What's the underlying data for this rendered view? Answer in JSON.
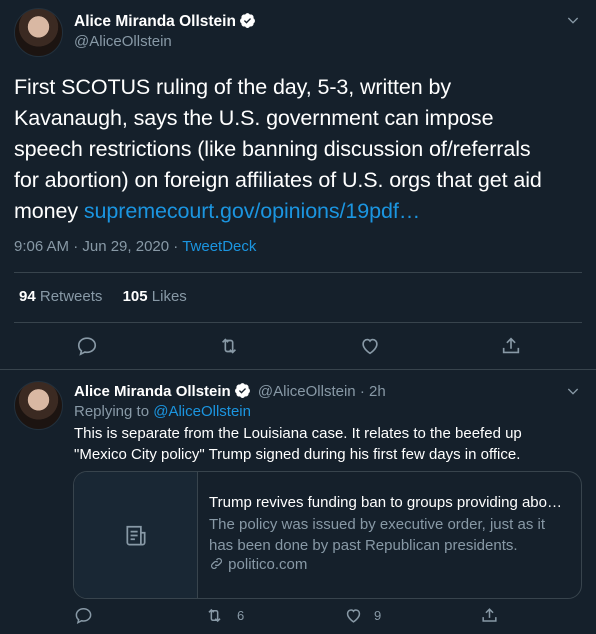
{
  "main_tweet": {
    "author_name": "Alice Miranda Ollstein",
    "handle": "@AliceOllstein",
    "text_line1": "First SCOTUS ruling of the day, 5-3, written by",
    "text_line2": "Kavanaugh, says the U.S. government can impose",
    "text_line3": "speech restrictions (like banning discussion of/referrals",
    "text_line4": "for abortion) on foreign affiliates of U.S. orgs that get aid",
    "text_line5_prefix": "money ",
    "link": "supremecourt.gov/opinions/19pdf…",
    "timestamp": "9:06 AM · Jun 29, 2020",
    "separator": "·",
    "client": "TweetDeck",
    "retweets_count": "94",
    "retweets_label": "Retweets",
    "likes_count": "105",
    "likes_label": "Likes"
  },
  "reply_tweet": {
    "author_name": "Alice Miranda Ollstein",
    "handle_time": "@AliceOllstein · 2h",
    "replying_to_label": "Replying to",
    "replying_to_handle": "@AliceOllstein",
    "text_line1": "This is separate from the Louisiana case. It relates to the beefed up",
    "text_line2": "\"Mexico City policy\" Trump signed during his first few days in office.",
    "card": {
      "title": "Trump revives funding ban to groups providing abo…",
      "description_line1": "The policy was issued by executive order, just as it",
      "description_line2": "has been done by past Republican presidents.",
      "domain": "politico.com"
    },
    "retweet_count": "6",
    "like_count": "9"
  },
  "colors": {
    "background": "#15202b",
    "text": "#ffffff",
    "muted": "#8899a6",
    "link": "#1b95e0",
    "divider": "#38444d"
  }
}
